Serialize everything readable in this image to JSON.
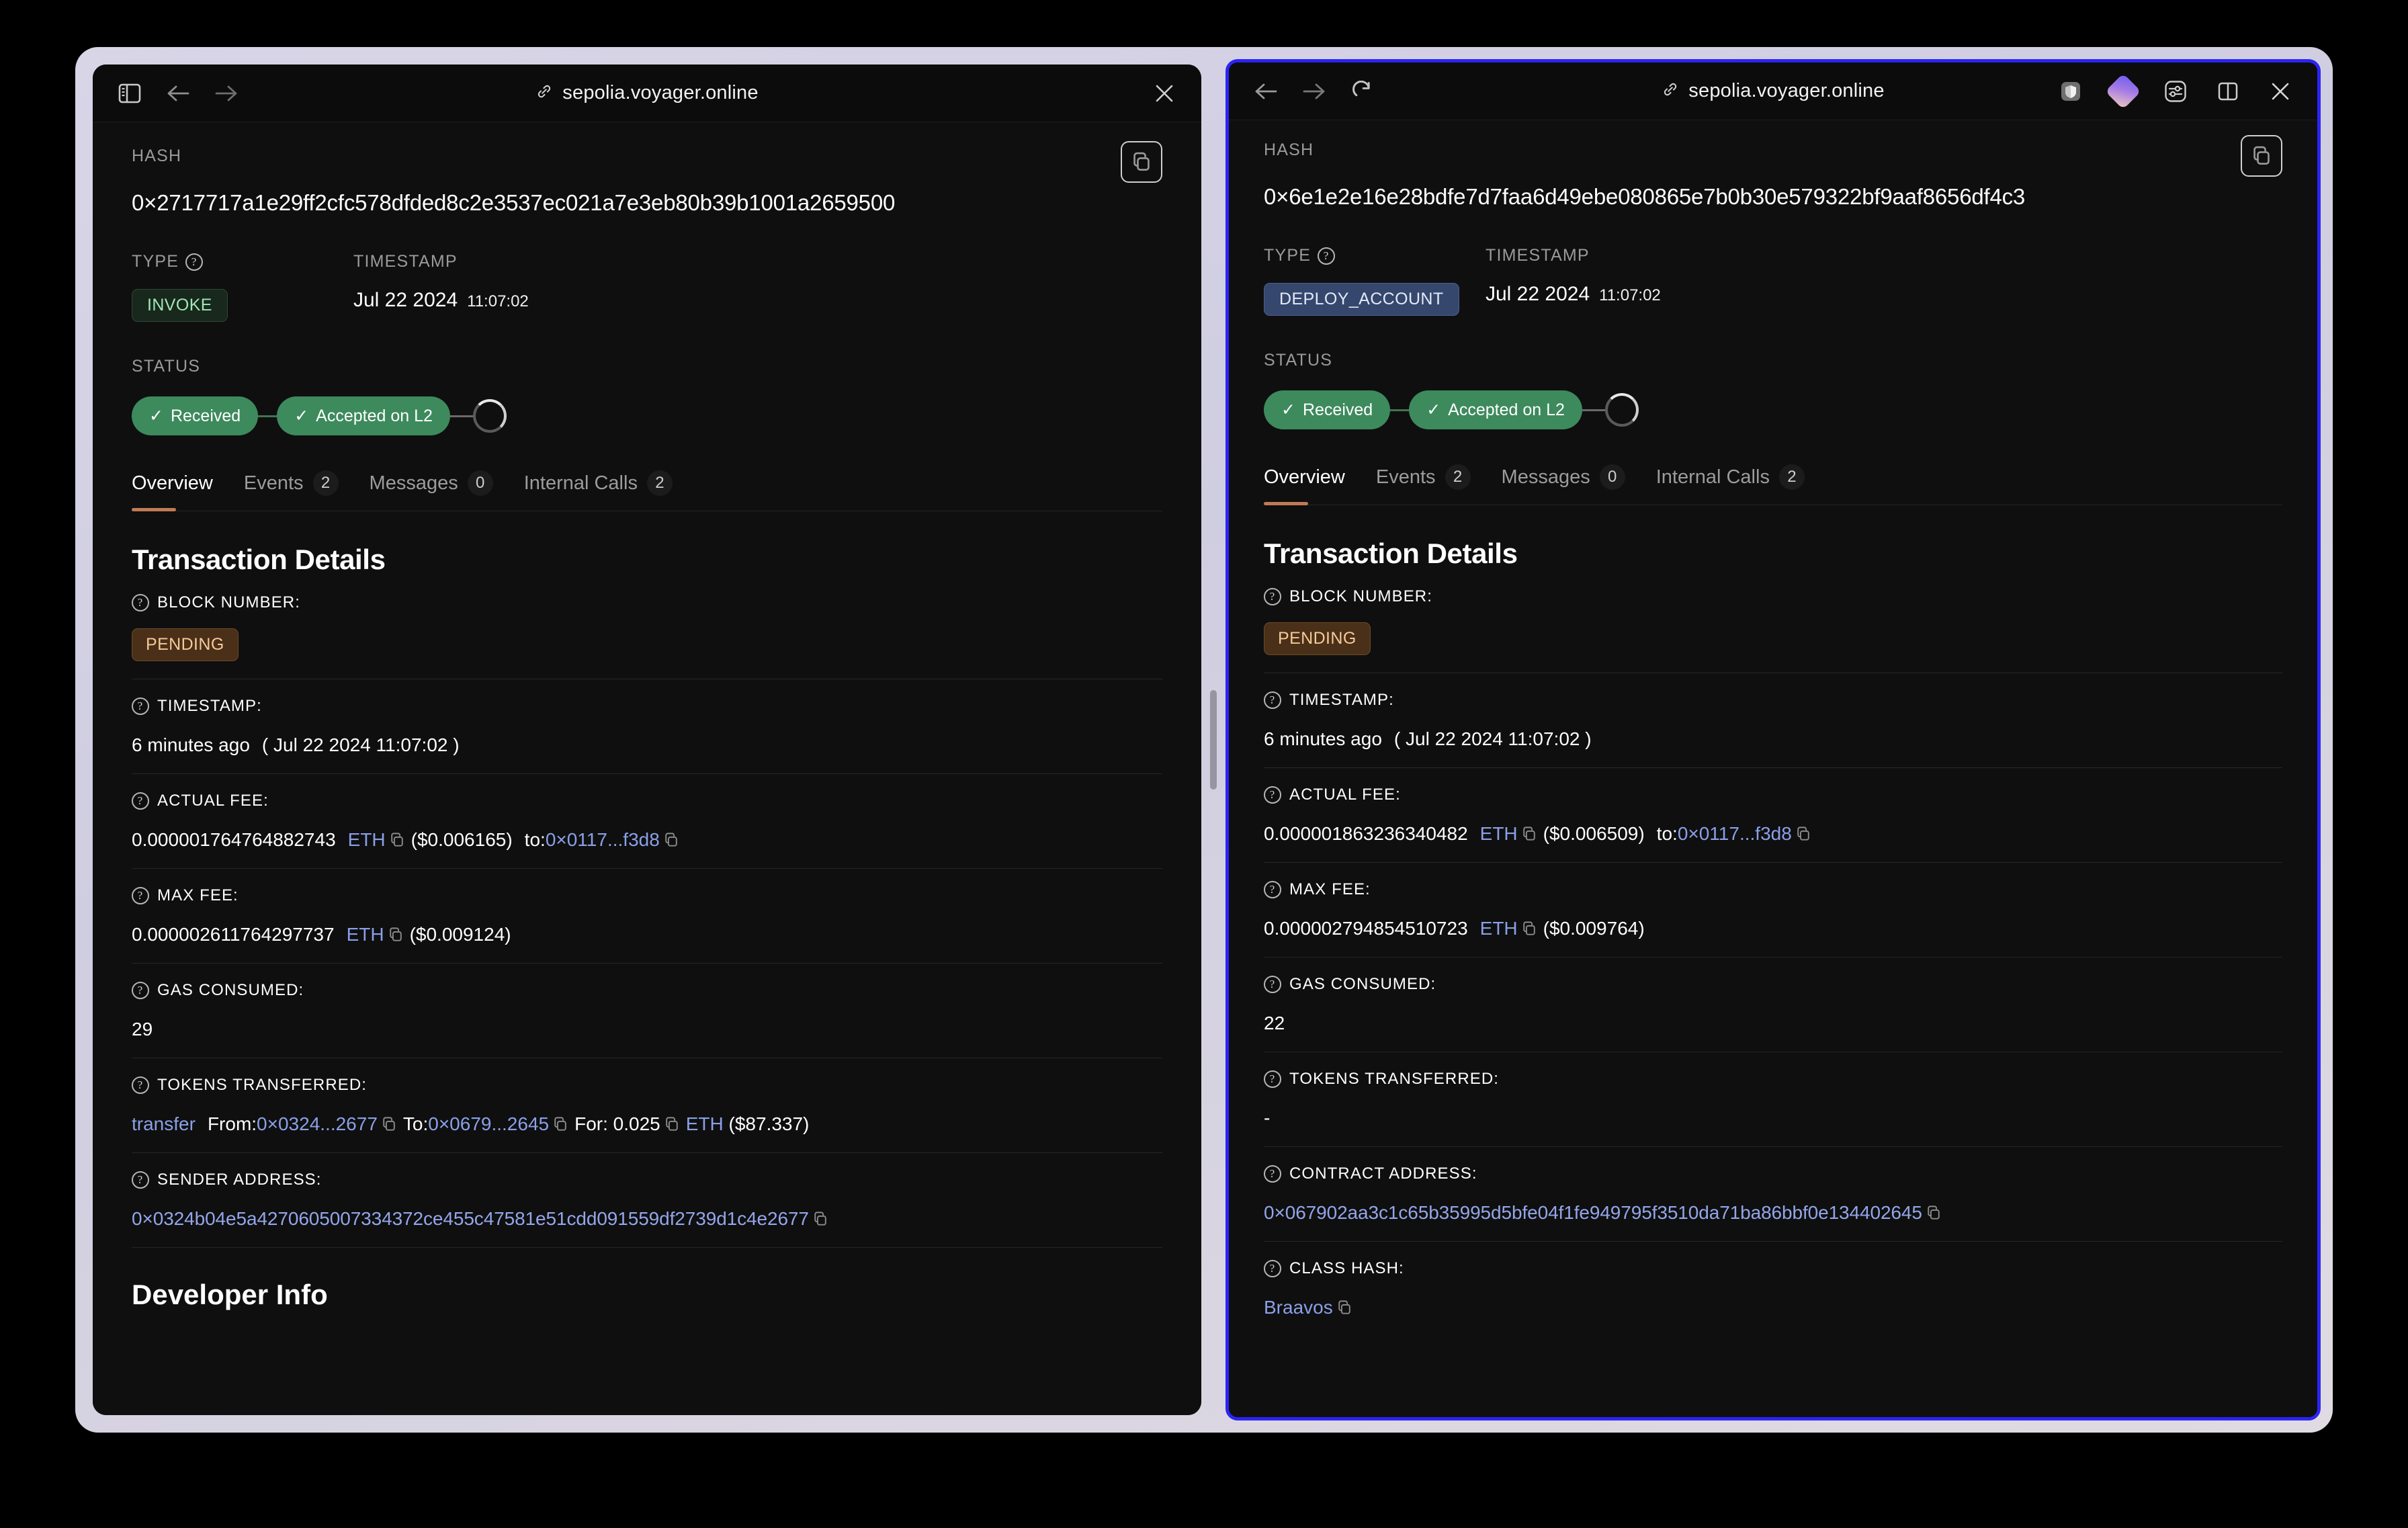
{
  "windows": [
    {
      "id": "left",
      "active": false,
      "toolbar": {
        "url": "sepolia.voyager.online",
        "sidebar_toggle": "sidebar-toggle",
        "back": "back",
        "forward": "forward",
        "close": "close"
      },
      "hash_label": "HASH",
      "hash_value": "0×2717717a1e29ff2cfc578dfded8c2e3537ec021a7e3eb80b39b1001a2659500",
      "type_label": "TYPE",
      "type_badge": "INVOKE",
      "timestamp_label": "TIMESTAMP",
      "timestamp_date": "Jul 22 2024",
      "timestamp_time": "11:07:02",
      "status_label": "STATUS",
      "status_steps": [
        {
          "label": "Received",
          "done": true
        },
        {
          "label": "Accepted on L2",
          "done": true
        }
      ],
      "tabs": [
        {
          "label": "Overview",
          "count": "",
          "active": true
        },
        {
          "label": "Events",
          "count": "2",
          "active": false
        },
        {
          "label": "Messages",
          "count": "0",
          "active": false
        },
        {
          "label": "Internal Calls",
          "count": "2",
          "active": false
        }
      ],
      "details_title": "Transaction Details",
      "details": {
        "block_number_label": "BLOCK NUMBER:",
        "block_number_value": "PENDING",
        "timestamp_label": "TIMESTAMP:",
        "timestamp_rel": "6 minutes ago",
        "timestamp_abs": "(  Jul 22 2024   11:07:02  )",
        "actual_fee_label": "ACTUAL FEE:",
        "actual_fee_amount": "0.000001764764882743",
        "actual_fee_token": "ETH",
        "actual_fee_usd": "($0.006165)",
        "actual_fee_to_label": "to:",
        "actual_fee_to_addr": "0×0117...f3d8",
        "max_fee_label": "MAX FEE:",
        "max_fee_amount": "0.000002611764297737",
        "max_fee_token": "ETH",
        "max_fee_usd": "($0.009124)",
        "gas_consumed_label": "GAS CONSUMED:",
        "gas_consumed_value": "29",
        "tokens_transferred_label": "TOKENS TRANSFERRED:",
        "transfer_action": "transfer",
        "transfer_from_label": "From:",
        "transfer_from_addr": "0×0324...2677",
        "transfer_to_label": "To:",
        "transfer_to_addr": "0×0679...2645",
        "transfer_for_label": "For:",
        "transfer_amount": "0.025",
        "transfer_token": "ETH",
        "transfer_usd": "($87.337)",
        "sender_address_label": "SENDER ADDRESS:",
        "sender_address_value": "0×0324b04e5a4270605007334372ce455c47581e51cdd091559df2739d1c4e2677"
      },
      "developer_info_title": "Developer Info"
    },
    {
      "id": "right",
      "active": true,
      "toolbar": {
        "url": "sepolia.voyager.online",
        "back": "back",
        "forward": "forward",
        "reload": "reload",
        "shield": "shield",
        "diamond": "extension",
        "sliders": "settings",
        "split": "split-view",
        "close": "close"
      },
      "hash_label": "HASH",
      "hash_value": "0×6e1e2e16e28bdfe7d7faa6d49ebe080865e7b0b30e579322bf9aaf8656df4c3",
      "type_label": "TYPE",
      "type_badge": "DEPLOY_ACCOUNT",
      "timestamp_label": "TIMESTAMP",
      "timestamp_date": "Jul 22 2024",
      "timestamp_time": "11:07:02",
      "status_label": "STATUS",
      "status_steps": [
        {
          "label": "Received",
          "done": true
        },
        {
          "label": "Accepted on L2",
          "done": true
        }
      ],
      "tabs": [
        {
          "label": "Overview",
          "count": "",
          "active": true
        },
        {
          "label": "Events",
          "count": "2",
          "active": false
        },
        {
          "label": "Messages",
          "count": "0",
          "active": false
        },
        {
          "label": "Internal Calls",
          "count": "2",
          "active": false
        }
      ],
      "details_title": "Transaction Details",
      "details": {
        "block_number_label": "BLOCK NUMBER:",
        "block_number_value": "PENDING",
        "timestamp_label": "TIMESTAMP:",
        "timestamp_rel": "6 minutes ago",
        "timestamp_abs": "(  Jul 22 2024   11:07:02  )",
        "actual_fee_label": "ACTUAL FEE:",
        "actual_fee_amount": "0.000001863236340482",
        "actual_fee_token": "ETH",
        "actual_fee_usd": "($0.006509)",
        "actual_fee_to_label": "to:",
        "actual_fee_to_addr": "0×0117...f3d8",
        "max_fee_label": "MAX FEE:",
        "max_fee_amount": "0.000002794854510723",
        "max_fee_token": "ETH",
        "max_fee_usd": "($0.009764)",
        "gas_consumed_label": "GAS CONSUMED:",
        "gas_consumed_value": "22",
        "tokens_transferred_label": "TOKENS TRANSFERRED:",
        "tokens_transferred_value": "-",
        "contract_address_label": "CONTRACT ADDRESS:",
        "contract_address_value": "0×067902aa3c1c65b35995d5bfe04f1fe949795f3510da71ba86bbf0e134402645",
        "class_hash_label": "CLASS HASH:",
        "class_hash_value": "Braavos"
      }
    }
  ],
  "colors": {
    "accent_tab": "#c07a55",
    "status_green": "#3d8a5d",
    "link_blue": "#8aa0e8",
    "badge_invoke_bg": "#18281c",
    "badge_invoke_fg": "#9fe7b8",
    "badge_deploy_bg": "#36476e",
    "badge_pending_bg": "#4a3018",
    "badge_pending_fg": "#f7c998",
    "active_window_border": "#2b24f5",
    "frame": "#d5d3e4"
  }
}
